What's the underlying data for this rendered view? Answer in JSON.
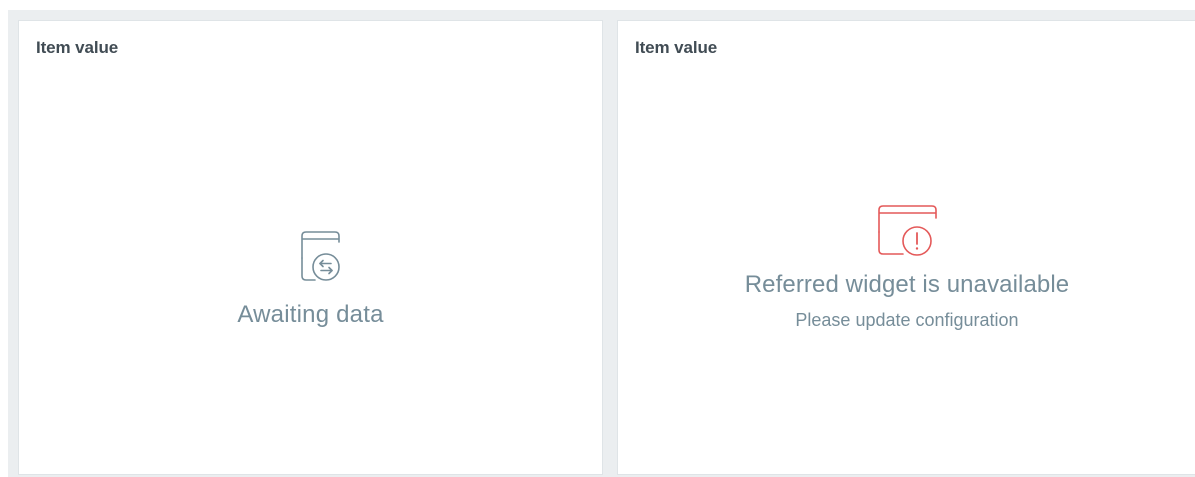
{
  "widgets": [
    {
      "header": "Item value",
      "state": "awaiting",
      "message": "Awaiting data",
      "icon": "awaiting-data-icon"
    },
    {
      "header": "Item value",
      "state": "unavailable",
      "message": "Referred widget is unavailable",
      "sub_message": "Please update configuration",
      "icon": "widget-unavailable-icon"
    }
  ],
  "colors": {
    "dashboard_background": "#ebeef0",
    "widget_background": "#ffffff",
    "header_text": "#414c54",
    "muted_text": "#768d99",
    "awaiting_icon": "#768d99",
    "error_icon": "#e45959"
  }
}
